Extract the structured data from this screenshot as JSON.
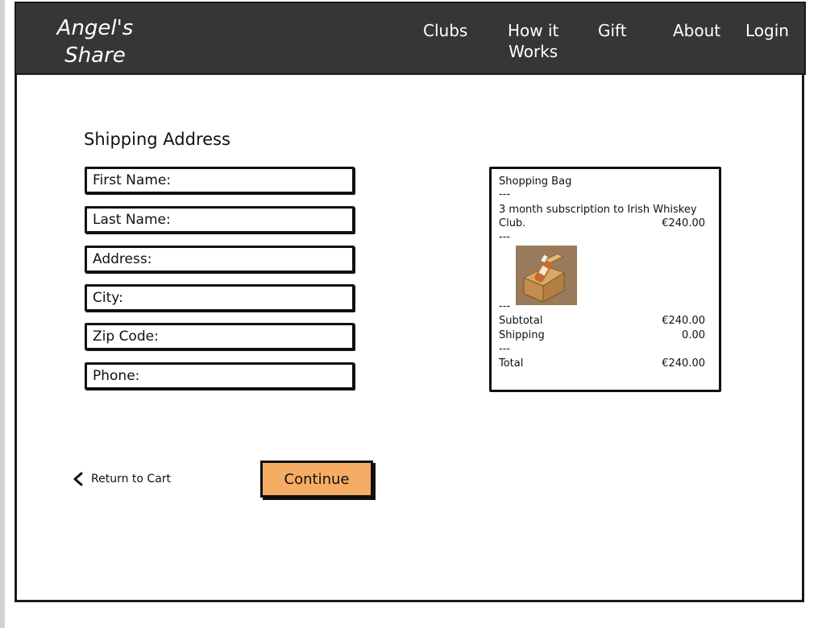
{
  "header": {
    "logo": "Angel's\nShare",
    "nav": {
      "clubs": "Clubs",
      "how": "How it\nWorks",
      "gift": "Gift",
      "about": "About",
      "login": "Login"
    }
  },
  "form": {
    "title": "Shipping Address",
    "fields": {
      "first": "First Name:",
      "last": "Last Name:",
      "address": "Address:",
      "city": "City:",
      "zip": "Zip Code:",
      "phone": "Phone:"
    }
  },
  "bag": {
    "title": "Shopping Bag",
    "sep": "---",
    "item_line1": "3 month subscription to Irish Whiskey",
    "item_line2": "Club.",
    "item_price": "€240.00",
    "subtotal_label": "Subtotal",
    "subtotal_value": "€240.00",
    "shipping_label": "Shipping",
    "shipping_value": "0.00",
    "total_label": "Total",
    "total_value": "€240.00"
  },
  "actions": {
    "back": "Return to Cart",
    "continue": "Continue"
  }
}
